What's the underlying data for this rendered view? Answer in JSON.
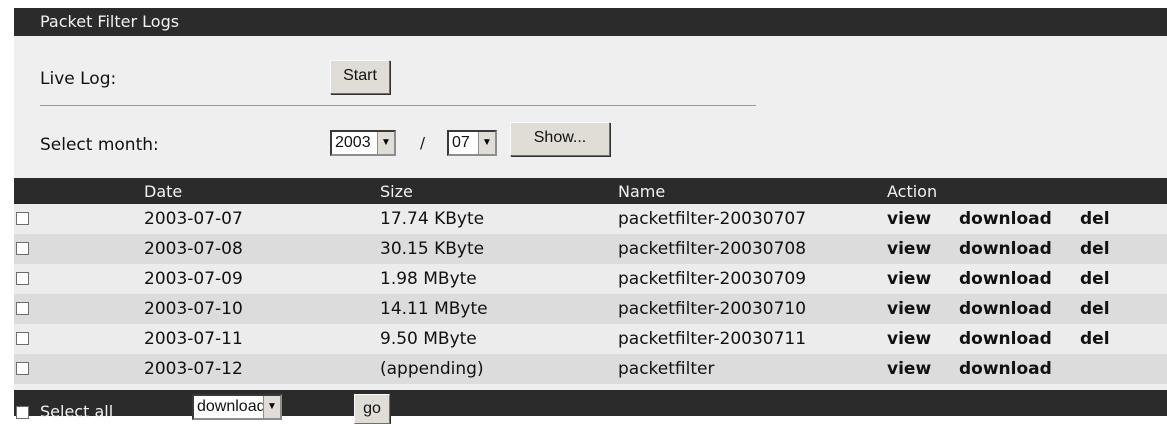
{
  "panel": {
    "title": "Packet Filter Logs"
  },
  "live_log": {
    "label": "Live Log:",
    "start_label": "Start"
  },
  "month_select": {
    "label": "Select month:",
    "year": "2003",
    "separator": "/",
    "month": "07",
    "show_label": "Show..."
  },
  "table": {
    "headers": {
      "date": "Date",
      "size": "Size",
      "name": "Name",
      "action": "Action"
    },
    "rows": [
      {
        "date": "2003-07-07",
        "size": "17.74 KByte",
        "name": "packetfilter-20030707",
        "view": "view",
        "download": "download",
        "del": "del"
      },
      {
        "date": "2003-07-08",
        "size": "30.15 KByte",
        "name": "packetfilter-20030708",
        "view": "view",
        "download": "download",
        "del": "del"
      },
      {
        "date": "2003-07-09",
        "size": "1.98 MByte",
        "name": "packetfilter-20030709",
        "view": "view",
        "download": "download",
        "del": "del"
      },
      {
        "date": "2003-07-10",
        "size": "14.11 MByte",
        "name": "packetfilter-20030710",
        "view": "view",
        "download": "download",
        "del": "del"
      },
      {
        "date": "2003-07-11",
        "size": "9.50 MByte",
        "name": "packetfilter-20030711",
        "view": "view",
        "download": "download",
        "del": "del"
      },
      {
        "date": "2003-07-12",
        "size": "(appending)",
        "name": "packetfilter",
        "view": "view",
        "download": "download",
        "del": ""
      }
    ]
  },
  "footer": {
    "select_all": "Select all",
    "action_value": "download",
    "go_label": "go"
  },
  "icons": {
    "dropdown": "chevron-down-icon",
    "checkbox": "checkbox-icon"
  },
  "colors": {
    "bar_dark": "#2b2b2b",
    "row_light": "#ececec",
    "row_mid": "#dcdcdc",
    "panel_bg": "#efefef"
  }
}
